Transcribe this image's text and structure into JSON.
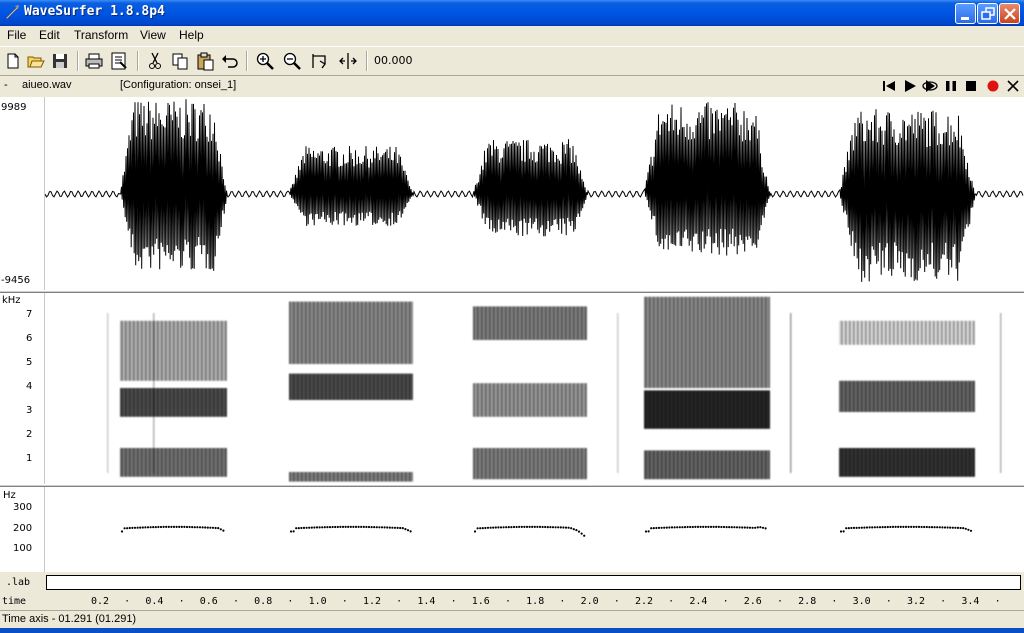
{
  "window": {
    "title": "WaveSurfer 1.8.8p4"
  },
  "menu": [
    "File",
    "Edit",
    "Transform",
    "View",
    "Help"
  ],
  "toolbar": {
    "time_readout": "00.000"
  },
  "file": {
    "dash": "-",
    "name": "aiueo.wav",
    "configuration": "[Configuration: onsei_1]"
  },
  "waveform": {
    "max_label": "9989",
    "min_label": "-9456"
  },
  "spectrogram": {
    "unit": "kHz",
    "ticks": [
      "7",
      "6",
      "5",
      "4",
      "3",
      "2",
      "1"
    ]
  },
  "pitch": {
    "unit": "Hz",
    "ticks": [
      "300",
      "200",
      "100"
    ]
  },
  "label_pane": {
    "name": ".lab"
  },
  "time_axis": {
    "name": "time",
    "ticks": [
      "0.2",
      "0.4",
      "0.6",
      "0.8",
      "1.0",
      "1.2",
      "1.4",
      "1.6",
      "1.8",
      "2.0",
      "2.2",
      "2.4",
      "2.6",
      "2.8",
      "3.0",
      "3.2",
      "3.4"
    ]
  },
  "status": {
    "text": "Time axis - 01.291 (01.291)"
  },
  "icons": {
    "file": [
      "new-icon",
      "open-icon",
      "save-icon",
      "print-icon",
      "properties-icon",
      "cut-icon",
      "copy-icon",
      "paste-icon",
      "undo-icon",
      "zoom-in-icon",
      "zoom-out-icon",
      "zoom-selection-icon",
      "zoom-fit-icon"
    ],
    "playback": [
      "skip-to-start-icon",
      "play-icon",
      "play-loop-icon",
      "pause-icon",
      "stop-icon",
      "record-icon",
      "close-icon"
    ]
  },
  "colors": {
    "titlebar": "#0054e3",
    "record": "#e01010",
    "signal": "#000000"
  }
}
